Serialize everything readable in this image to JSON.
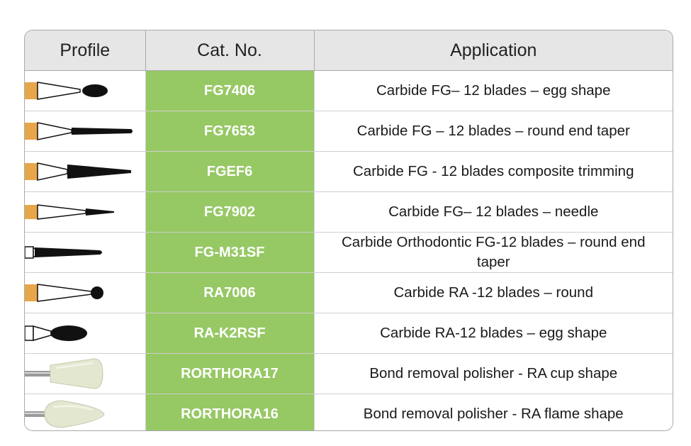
{
  "headers": {
    "profile": "Profile",
    "cat_no": "Cat. No.",
    "application": "Application"
  },
  "rows": [
    {
      "cat_no": "FG7406",
      "application": "Carbide FG– 12 blades – egg shape",
      "icon": "bur-egg-icon"
    },
    {
      "cat_no": "FG7653",
      "application": "Carbide FG – 12 blades – round end taper",
      "icon": "bur-round-end-taper-icon"
    },
    {
      "cat_no": "FGEF6",
      "application": "Carbide FG - 12 blades composite trimming",
      "icon": "bur-composite-trimming-icon"
    },
    {
      "cat_no": "FG7902",
      "application": "Carbide FG– 12 blades – needle",
      "icon": "bur-needle-icon"
    },
    {
      "cat_no": "FG-M31SF",
      "application": "Carbide Orthodontic FG-12 blades – round end taper",
      "icon": "bur-orthodontic-taper-icon"
    },
    {
      "cat_no": "RA7006",
      "application": "Carbide RA -12 blades – round",
      "icon": "bur-round-icon"
    },
    {
      "cat_no": "RA-K2RSF",
      "application": "Carbide RA-12 blades – egg shape",
      "icon": "bur-ra-egg-icon"
    },
    {
      "cat_no": "RORTHORA17",
      "application": "Bond removal polisher - RA cup shape",
      "icon": "polisher-cup-icon"
    },
    {
      "cat_no": "RORTHORA16",
      "application": "Bond removal polisher - RA flame shape",
      "icon": "polisher-flame-icon"
    }
  ],
  "colors": {
    "cat_bg": "#96c864",
    "header_bg": "#e6e6e6",
    "shank_gold": "#e8a64b"
  }
}
